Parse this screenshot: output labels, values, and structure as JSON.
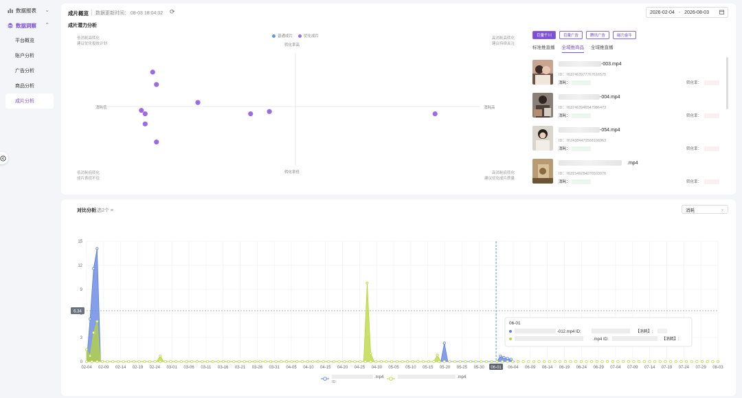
{
  "sidebar": {
    "groups": [
      {
        "label": "数据报表",
        "expanded": false
      },
      {
        "label": "数据洞察",
        "expanded": true
      }
    ],
    "items": [
      {
        "label": "平台概览"
      },
      {
        "label": "账户分析"
      },
      {
        "label": "广告分析"
      },
      {
        "label": "商品分析"
      },
      {
        "label": "成片分析",
        "active": true
      }
    ]
  },
  "header": {
    "title": "成片概览",
    "update_label": "数据更新时间：",
    "update_time": "08-03 18:04:32",
    "date_start": "2026-02-04",
    "date_sep": "-",
    "date_end": "2026-08-03"
  },
  "quadrant": {
    "title": "成片潜力分析",
    "legend": [
      {
        "label": "普通成片",
        "color": "#5b9bd5"
      },
      {
        "label": "优化成片",
        "color": "#9b6be6"
      }
    ],
    "corners": {
      "top_left": [
        "低消耗高转化",
        "建议优化投放计划"
      ],
      "top_right": [
        "高消耗高转化",
        "建议持续关注"
      ],
      "bottom_left": [
        "低消耗低转化",
        "成片表现不佳"
      ],
      "bottom_right": [
        "高消耗低转化",
        "建议优化成片质量"
      ]
    },
    "axis": {
      "top": "转化率高",
      "bottom": "转化率低",
      "left": "消耗低",
      "right": "消耗高"
    }
  },
  "panel": {
    "chips": [
      {
        "label": "巨量千川",
        "active": true
      },
      {
        "label": "巨量广告",
        "active": false
      },
      {
        "label": "腾讯广告",
        "active": false
      },
      {
        "label": "磁力金牛",
        "active": false
      }
    ],
    "subtabs": [
      {
        "label": "标准推直播",
        "active": false
      },
      {
        "label": "全域推商品",
        "active": true
      },
      {
        "label": "全域推直播",
        "active": false
      }
    ],
    "cost_label": "消耗：",
    "rate_label": "转化率：",
    "videos": [
      {
        "name_suffix": "-003.mp4",
        "id": "ID：7637463977767616575"
      },
      {
        "name_suffix": "-004.mp4",
        "id": "ID：7637463946547986473"
      },
      {
        "name_suffix": "-054.mp4",
        "id": "ID：7624384479568166963"
      },
      {
        "name_suffix": ".mp4",
        "id": "ID：7631549284076503076"
      }
    ]
  },
  "compare": {
    "title": "对比分析",
    "selected": "已选2个 ≡",
    "metric": "消耗",
    "tooltip": {
      "date": "06-01",
      "row1_suffix": "-012.mp4 ID:",
      "row1_metric": "【消耗】:",
      "row2_suffix": ".mp4 ID:",
      "row2_metric": "【消耗】:"
    },
    "legend": [
      {
        "suffix": ".mp4",
        "id_prefix": "ID:",
        "color": "#5b7fe0"
      },
      {
        "suffix": ".mp4",
        "id_prefix": "",
        "color": "#b8d638"
      }
    ]
  },
  "chart_data": {
    "type": "area",
    "title": "",
    "xlabel": "",
    "ylabel": "",
    "ylim": [
      0,
      15
    ],
    "yticks": [
      0,
      3,
      6,
      9,
      12,
      15
    ],
    "avg_line_value": 6.34,
    "avg_line_label": "6.34",
    "highlight_x": "06-01",
    "x_tick_labels": [
      "02-04",
      "02-09",
      "02-14",
      "02-19",
      "02-24",
      "03-01",
      "03-06",
      "03-11",
      "03-16",
      "03-21",
      "03-26",
      "03-31",
      "04-05",
      "04-10",
      "04-15",
      "04-20",
      "04-25",
      "04-30",
      "05-05",
      "05-10",
      "05-15",
      "05-20",
      "05-25",
      "05-30",
      "06-01",
      "06-04",
      "06-09",
      "06-14",
      "06-19",
      "06-24",
      "06-29",
      "07-04",
      "07-09",
      "07-14",
      "07-19",
      "07-24",
      "07-29",
      "08-03"
    ],
    "series": [
      {
        "name": "",
        "color": "#5b7fe0",
        "points": [
          {
            "day": 0,
            "value": 0
          },
          {
            "day": 1,
            "value": 5.3
          },
          {
            "day": 2,
            "value": 11.6
          },
          {
            "day": 3,
            "value": 14.1
          },
          {
            "day": 4,
            "value": 0
          },
          {
            "day": 101,
            "value": 0
          },
          {
            "day": 102,
            "value": 2.3
          },
          {
            "day": 103,
            "value": 0
          },
          {
            "day": 117,
            "value": 0
          },
          {
            "day": 118,
            "value": 0.7
          },
          {
            "day": 119,
            "value": 0.5
          },
          {
            "day": 120,
            "value": 0.4
          },
          {
            "day": 121,
            "value": 0.3
          },
          {
            "day": 122,
            "value": 0
          }
        ]
      },
      {
        "name": "",
        "color": "#b8d638",
        "points": [
          {
            "day": 0,
            "value": 1.5
          },
          {
            "day": 1,
            "value": 0.7
          },
          {
            "day": 2,
            "value": 3.6
          },
          {
            "day": 3,
            "value": 5.0
          },
          {
            "day": 4,
            "value": 0
          },
          {
            "day": 20,
            "value": 0
          },
          {
            "day": 21,
            "value": 0.7
          },
          {
            "day": 22,
            "value": 0
          },
          {
            "day": 79,
            "value": 0
          },
          {
            "day": 80,
            "value": 9.8
          },
          {
            "day": 81,
            "value": 1.0
          },
          {
            "day": 82,
            "value": 0
          },
          {
            "day": 99,
            "value": 0
          },
          {
            "day": 100,
            "value": 0.8
          },
          {
            "day": 101,
            "value": 0
          }
        ]
      }
    ]
  },
  "scatter_data": {
    "type": "scatter",
    "x_range": [
      0,
      1
    ],
    "y_range": [
      0,
      1
    ],
    "points": [
      {
        "x": 0.13,
        "y": 0.83,
        "series": "优化成片"
      },
      {
        "x": 0.14,
        "y": 0.72,
        "series": "优化成片"
      },
      {
        "x": 0.25,
        "y": 0.56,
        "series": "优化成片"
      },
      {
        "x": 0.1,
        "y": 0.49,
        "series": "优化成片"
      },
      {
        "x": 0.11,
        "y": 0.46,
        "series": "优化成片"
      },
      {
        "x": 0.39,
        "y": 0.46,
        "series": "优化成片"
      },
      {
        "x": 0.44,
        "y": 0.48,
        "series": "优化成片"
      },
      {
        "x": 0.88,
        "y": 0.46,
        "series": "优化成片"
      },
      {
        "x": 0.11,
        "y": 0.37,
        "series": "优化成片"
      },
      {
        "x": 0.14,
        "y": 0.21,
        "series": "优化成片"
      }
    ]
  }
}
